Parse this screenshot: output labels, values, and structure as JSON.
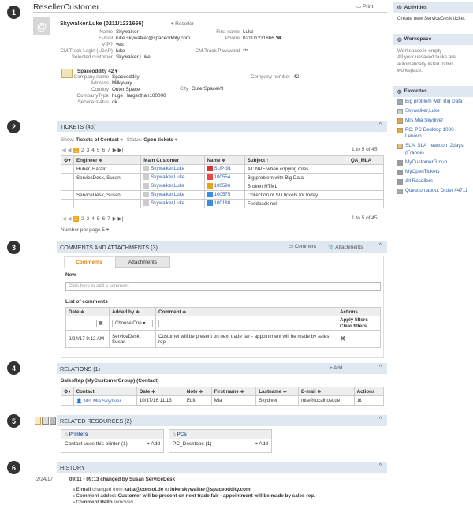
{
  "header": {
    "title": "ResellerCustomer",
    "print": "Print"
  },
  "customer": {
    "name": "Skywalker,Luke (0211/1231666)",
    "role": "Reseller",
    "left": [
      [
        "Name",
        "Skywalker"
      ],
      [
        "E-mail",
        "luke.skywalker@spaceoddity.com"
      ],
      [
        "VIP?",
        "yes"
      ],
      [
        "CM.Track Login (LDAP)",
        "luke"
      ],
      [
        "Selected customer",
        "Skywalker,Luke"
      ]
    ],
    "right": [
      [
        "First name",
        "Luke"
      ],
      [
        "Phone",
        "0211/1231666 ☎"
      ],
      [
        "",
        ""
      ],
      [
        "CM.Track Password",
        "***"
      ]
    ],
    "company": {
      "name": "Spaceoddity 42",
      "rows": [
        [
          "Company name",
          "Spaceoddity"
        ],
        [
          "Address",
          "Milkyway"
        ],
        [
          "Country",
          "Outer Space"
        ],
        [
          "CompanyType",
          "huge | largerthan100000"
        ],
        [
          "Service status",
          "ok"
        ]
      ],
      "city_label": "City",
      "city": "OuterSpace#9",
      "number_label": "Company number",
      "number": "42"
    }
  },
  "tickets": {
    "title": "TICKETS (45)",
    "show": "Show:",
    "show_val": "Tickets of Contact",
    "status": "Status:",
    "status_val": "Open tickets",
    "pages": [
      "1",
      "2",
      "3",
      "4",
      "5",
      "6",
      "7"
    ],
    "range": "1 to 5 of 45",
    "cols": [
      "Engineer ≑",
      "Main Customer",
      "Name ≑",
      "Subject ↑",
      "QA_MLA"
    ],
    "rows": [
      [
        "Huber, Harald",
        "Skywalker,Luke",
        "SUP-91",
        "AT: NPE when copying roles",
        ""
      ],
      [
        "ServiceDesk, Susan",
        "Skywalker,Luke",
        "100554",
        "Big problem with Big Data",
        ""
      ],
      [
        "",
        "Skywalker,Luke",
        "100596",
        "Broken HTML",
        ""
      ],
      [
        "ServiceDesk, Susan",
        "Skywalker,Luke",
        "100575",
        "Collection of SD tickets for today",
        ""
      ],
      [
        "",
        "Skywalker,Luke",
        "100188",
        "Feedback null",
        ""
      ]
    ],
    "per_page": "Number per page",
    "per_page_val": "5"
  },
  "comments": {
    "title": "COMMENTS AND ATTACHMENTS (3)",
    "comment_btn": "Comment",
    "attach_btn": "Attachments",
    "tabs": [
      "Comments",
      "Attachments"
    ],
    "new": "New",
    "placeholder": "Click here to add a comment",
    "list": "List of comments",
    "cols": [
      "Date ≑",
      "Added by ≑",
      "Comment ≑",
      "Actions"
    ],
    "choose": "Choose One",
    "apply": "Apply filters",
    "clear": "Clear filters",
    "row": {
      "date": "2/24/17 9:12 AM",
      "by": "ServiceDesk, Susan",
      "text": "Customer will be present on next trade fair - appointment will be made by sales rep."
    }
  },
  "relations": {
    "title": "RELATIONS (1)",
    "add": "+ Add",
    "group": "SalesRep (MyCustomerGroup) (Contact)",
    "cols": [
      "Contact",
      "Date ≑",
      "Note ≑",
      "First name ≑",
      "Lastname ≑",
      "E-mail ≑",
      "Actions"
    ],
    "row": [
      "Mrs Mia Skydiver",
      "10/17/16 11:13",
      "Edit",
      "Mia",
      "Skydiver",
      "mia@localhost.de"
    ]
  },
  "resources": {
    "title": "RELATED RESOURCES (2)",
    "printers": {
      "h": "Printers",
      "txt": "Contact uses this printer (1)",
      "add": "+ Add"
    },
    "pcs": {
      "h": "PCs",
      "txt": "PC_Desktops (1)",
      "add": "+ Add"
    }
  },
  "history": {
    "title": "HISTORY",
    "date": "2/24/17",
    "line": "09:11 - 09:13 changed by Susan ServiceDesk",
    "items": [
      {
        "a": "E-mail",
        "b": " changed from ",
        "c": "katja@consol.de",
        "d": " to ",
        "e": "luke.skywalker@spaceoddity.com"
      },
      {
        "a": "Comment added:",
        "b": " ",
        "c": "Customer will be present on next trade fair - appointment will be made by sales rep.",
        "d": "",
        "e": ""
      },
      {
        "a": "Comment",
        "b": " ",
        "c": "Hallo",
        "d": " removed",
        "e": ""
      }
    ]
  },
  "sidebar": {
    "activities": "Activities",
    "activities_txt": "Create new ServiceDesk ticket",
    "workspace": "Workspace",
    "workspace_txt": "Workspace is empty\nAll your unsaved tasks are automatically listed in this workspace.",
    "favorites": "Favorites",
    "favs": [
      "Big problem with Big Data",
      "Skywalker,Luke",
      "Mrs Mia Skydiver",
      "PC: PC Desktop 1000 - Lenovo",
      "SLA: SLA_reaction_2days (France)",
      "MyCustomerGroup",
      "MyOpenTickets",
      "All Resellers",
      "Question about Order #4711"
    ]
  },
  "steps": [
    "1",
    "2",
    "3",
    "4",
    "5",
    "6"
  ]
}
